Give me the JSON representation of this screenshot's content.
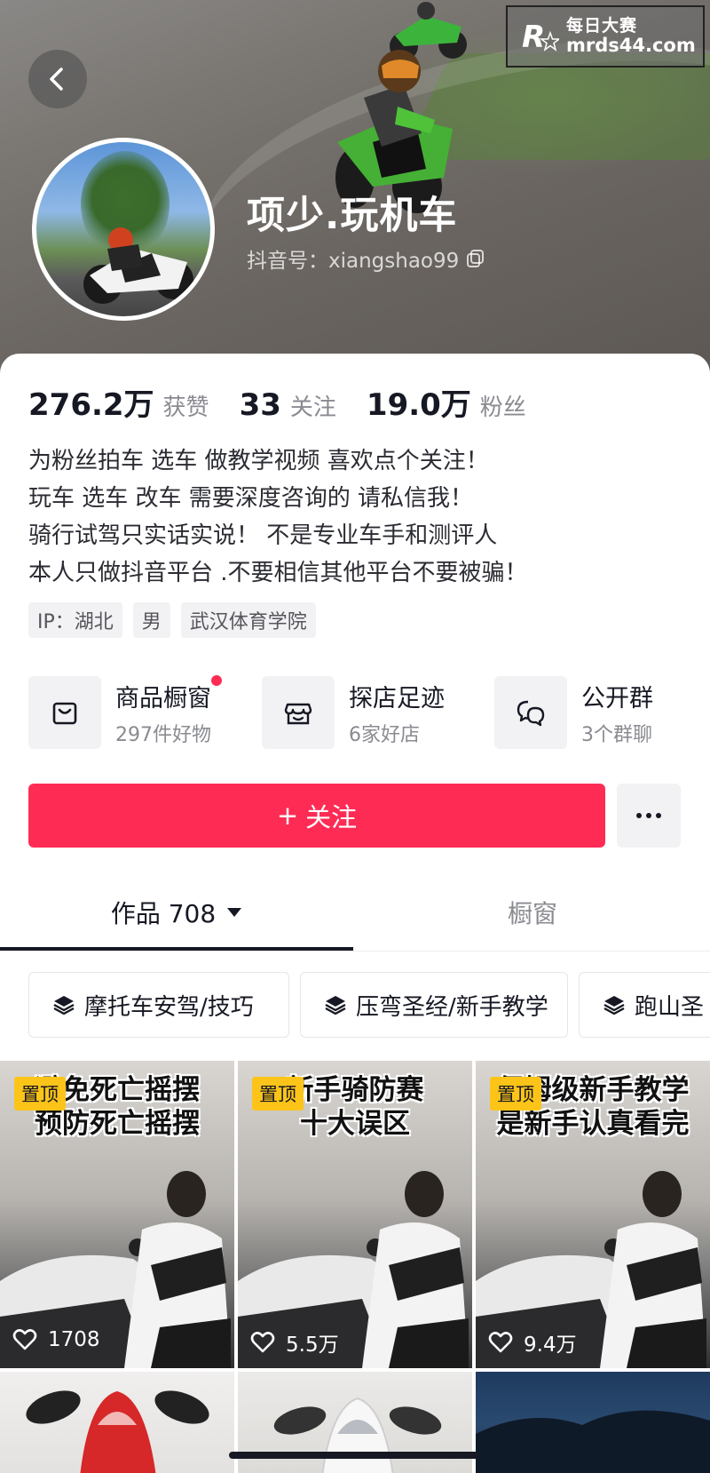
{
  "watermark": {
    "cn": "每日大赛",
    "url": "mrds44.com"
  },
  "profile": {
    "username": "项少.玩机车",
    "douyin_id": "抖音号：xiangshao99"
  },
  "stats": [
    {
      "value": "276.2万",
      "label": "获赞"
    },
    {
      "value": "33",
      "label": "关注"
    },
    {
      "value": "19.0万",
      "label": "粉丝"
    }
  ],
  "bio": [
    "为粉丝拍车 选车 做教学视频 喜欢点个关注！",
    "玩车 选车  改车  需要深度咨询的 请私信我！",
    "骑行试驾只实话实说！ 不是专业车手和测评人",
    "本人只做抖音平台 .不要相信其他平台不要被骗！"
  ],
  "tags": [
    "IP：湖北",
    "男",
    "武汉体育学院"
  ],
  "entries": [
    {
      "title": "商品橱窗",
      "sub": "297件好物",
      "icon": "shopping-bag-icon"
    },
    {
      "title": "探店足迹",
      "sub": "6家好店",
      "icon": "store-icon"
    },
    {
      "title": "公开群",
      "sub": "3个群聊",
      "icon": "chat-bubbles-icon"
    }
  ],
  "actions": {
    "follow_label": "关注",
    "follow_plus": "+"
  },
  "tabs": {
    "works_label": "作品 708",
    "showcase_label": "橱窗"
  },
  "collections": [
    "摩托车安驾/技巧",
    "压弯圣经/新手教学",
    "跑山圣"
  ],
  "videos": [
    {
      "caption_line1": "避免死亡摇摆",
      "caption_line2": "预防死亡摇摆",
      "pin": "置顶",
      "likes": "1708"
    },
    {
      "caption_line1": "新手骑防赛",
      "caption_line2": "十大误区",
      "pin": "置顶",
      "likes": "5.5万"
    },
    {
      "caption_line1": "保姆级新手教学",
      "caption_line2": "是新手认真看完",
      "pin": "置顶",
      "likes": "9.4万"
    }
  ],
  "colors": {
    "accent": "#fe2c55",
    "pin": "#fcc419"
  }
}
